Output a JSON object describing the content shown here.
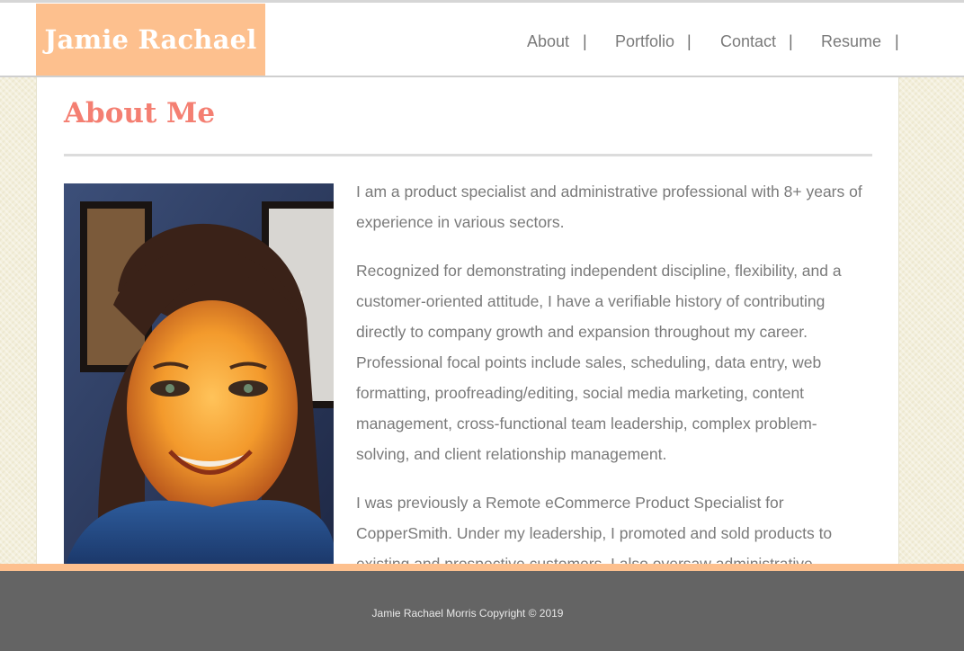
{
  "site": {
    "logo_text": "Jamie Rachael"
  },
  "nav": {
    "items": [
      {
        "label": "About"
      },
      {
        "label": "Portfolio"
      },
      {
        "label": "Contact"
      },
      {
        "label": "Resume"
      }
    ],
    "separator": "|"
  },
  "main": {
    "title": "About Me",
    "photo_alt": "Portrait of Jamie Rachael",
    "paragraphs": [
      "I am a product specialist and administrative professional with 8+ years of experience in various sectors.",
      "Recognized for demonstrating independent discipline, flexibility, and a customer-oriented attitude, I have a verifiable history of contributing directly to company growth and expansion throughout my career. Professional focal points include sales, scheduling, data entry, web formatting, proofreading/editing, social media marketing, content management, cross-functional team leadership, complex problem-solving, and client relationship management.",
      "I was previously a Remote eCommerce Product Specialist for CopperSmith. Under my leadership, I promoted and sold products to existing and prospective customers. I also oversaw administrative"
    ]
  },
  "footer": {
    "copyright": "Jamie Rachael Morris Copyright © 2019"
  },
  "colors": {
    "accent": "#fdc08e",
    "title": "#f47f72",
    "text": "#7a7a7a",
    "footer": "#646464"
  }
}
